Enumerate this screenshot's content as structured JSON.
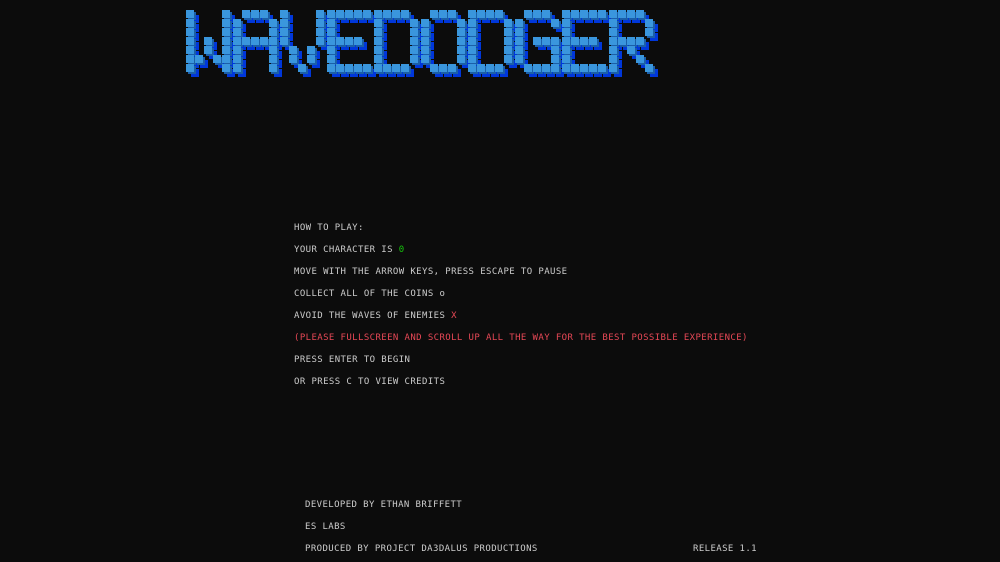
{
  "title": "WAVEDODGER",
  "colors": {
    "background": "#0c0c0c",
    "text": "#cccccc",
    "title_fill": "#3a96dd",
    "title_shadow": "#0037da",
    "player": "#16c60c",
    "enemy": "#e74856",
    "warning": "#e74856"
  },
  "instructions": {
    "heading": "HOW TO PLAY:",
    "character_prefix": "YOUR CHARACTER IS ",
    "character_symbol": "0",
    "move": "MOVE WITH THE ARROW KEYS, PRESS ESCAPE TO PAUSE",
    "coins_prefix": "COLLECT ALL OF THE COINS ",
    "coin_symbol": "o",
    "enemies_prefix": "AVOID THE WAVES OF ENEMIES ",
    "enemy_symbol": "X",
    "fullscreen_note": "(PLEASE FULLSCREEN AND SCROLL UP ALL THE WAY FOR THE BEST POSSIBLE EXPERIENCE)",
    "begin": "PRESS ENTER TO BEGIN",
    "credits": "OR PRESS C TO VIEW CREDITS"
  },
  "footer": {
    "developer": "DEVELOPED BY ETHAN BRIFFETT",
    "studio": "ES LABS",
    "producer": "PRODUCED BY PROJECT DA3DALUS PRODUCTIONS",
    "release": "RELEASE 1.1"
  }
}
